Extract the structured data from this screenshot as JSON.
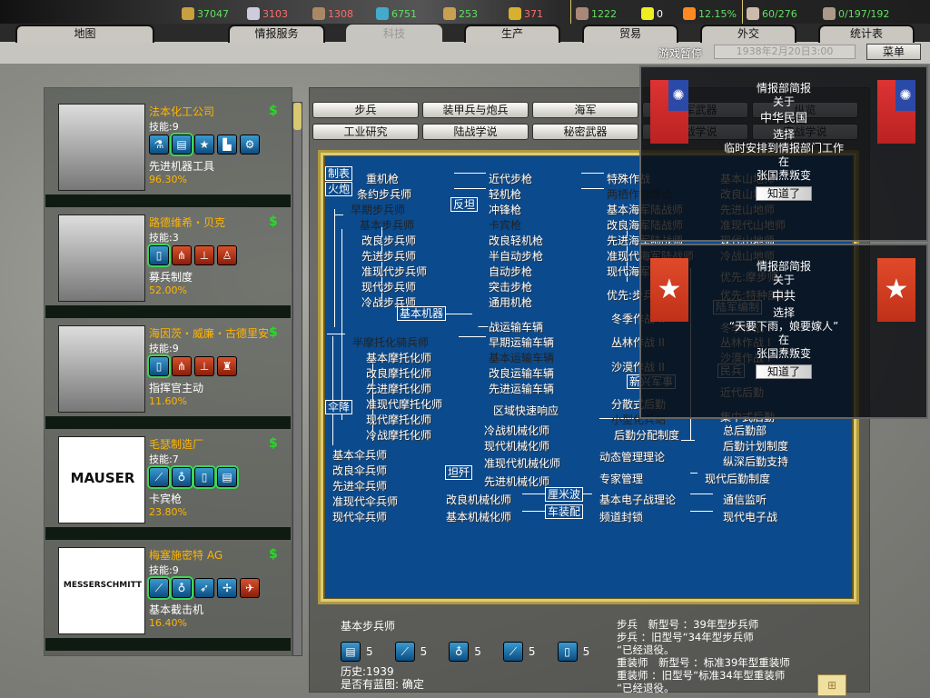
{
  "resources": [
    {
      "name": "energy",
      "icon": "energy-icon",
      "value": "37047",
      "color": "#5fe05f"
    },
    {
      "name": "metal",
      "icon": "metal-icon",
      "value": "3103",
      "color": "#ff6b6b"
    },
    {
      "name": "rare-materials",
      "icon": "rare-materials-icon",
      "value": "1308",
      "color": "#ff6b6b"
    },
    {
      "name": "oil",
      "icon": "oil-icon",
      "value": "6751",
      "color": "#5fe05f"
    },
    {
      "name": "supplies",
      "icon": "supplies-icon",
      "value": "253",
      "color": "#5fe05f"
    },
    {
      "name": "money",
      "icon": "money-icon",
      "value": "371",
      "color": "#ff6b6b"
    },
    {
      "name": "manpower",
      "icon": "manpower-icon",
      "value": "1222",
      "color": "#5fe05f"
    },
    {
      "name": "nuclear",
      "icon": "nuclear-icon",
      "value": "0",
      "color": "#ffffff"
    },
    {
      "name": "dissent",
      "icon": "dissent-icon",
      "value": "12.15%",
      "color": "#5fe05f"
    },
    {
      "name": "transport",
      "icon": "transport-icon",
      "value": "60/276",
      "color": "#5fe05f"
    },
    {
      "name": "ic",
      "icon": "industry-icon",
      "value": "0/197/192",
      "color": "#5fe05f"
    }
  ],
  "tabs": [
    "地图",
    "情报服务",
    "科技",
    "生产",
    "贸易",
    "外交",
    "统计表"
  ],
  "active_tab": "科技",
  "status": {
    "paused": "游戏暂停",
    "date": "1938年2月20日3:00",
    "menu": "菜单"
  },
  "teams": [
    {
      "name": "法本化工公司",
      "skill": "技能:9",
      "icons": [
        "flask",
        "blueprint",
        "star",
        "factory",
        "gears"
      ],
      "project": "先进机器工具",
      "progress": "96.30%"
    },
    {
      "name": "路德维希・贝克",
      "skill": "技能:3",
      "icons": [
        "book",
        "infantry-split",
        "org-chart",
        "officer"
      ],
      "project": "募兵制度",
      "progress": "52.00%"
    },
    {
      "name": "海因茨・威廉・古德里安",
      "skill": "技能:9",
      "icons": [
        "book",
        "infantry-split",
        "org-chart",
        "tank-officer"
      ],
      "project": "指挥官主动",
      "progress": "11.60%"
    },
    {
      "name": "毛瑟制造厂",
      "skill": "技能:7",
      "icons": [
        "rifle",
        "lightbulb",
        "book",
        "blueprint"
      ],
      "project": "卡宾枪",
      "progress": "23.80%"
    },
    {
      "name": "梅塞施密特 AG",
      "skill": "技能:9",
      "icons": [
        "rifle",
        "lightbulb",
        "rocket",
        "propeller",
        "aircraft"
      ],
      "project": "基本截击机",
      "progress": "16.40%"
    }
  ],
  "team_logos": [
    "MAUSER",
    "MESSERSCHMITT"
  ],
  "subtabs": [
    [
      "步兵",
      "装甲兵与炮兵",
      "海军",
      "空军武器",
      "纵览"
    ],
    [
      "工业研究",
      "陆战学说",
      "秘密武器",
      "海战学说",
      "空战学说"
    ]
  ],
  "techs": {
    "col1": [
      "重机枪",
      "条约步兵师",
      "早期步兵师",
      "基本步兵师",
      "改良步兵师",
      "先进步兵师",
      "准现代步兵师",
      "现代步兵师",
      "冷战步兵师"
    ],
    "col2": [
      "近代步枪",
      "轻机枪",
      "冲锋枪",
      "卡宾枪",
      "改良轻机枪",
      "半自动步枪",
      "自动步枪",
      "突击步枪",
      "通用机枪"
    ],
    "transport": [
      "一战运输车辆",
      "早期运输车辆",
      "基本运输车辆",
      "改良运输车辆",
      "先进运输车辆"
    ],
    "motor": [
      "半摩托化骑兵师",
      "基本摩托化师",
      "改良摩托化师",
      "先进摩托化师",
      "准现代摩托化师",
      "现代摩托化师",
      "冷战摩托化师"
    ],
    "mech": [
      "区域快速响应",
      "冷战机械化师",
      "现代机械化师",
      "准现代机械化师",
      "先进机械化师",
      "改良机械化师",
      "基本机械化师"
    ],
    "para": [
      "基本伞兵师",
      "改良伞兵师",
      "先进伞兵师",
      "准现代伞兵师",
      "现代伞兵师"
    ],
    "col3": [
      "特殊作战",
      "两栖作战理论",
      "基本海军陆战师",
      "改良海军陆战师",
      "先进海军陆战师",
      "准现代海军陆战师",
      "现代海军陆战师",
      "优先:步兵",
      "冬季作战 II",
      "丛林作战 II",
      "沙漠作战 II",
      "分散式后勤",
      "小型化兵站",
      "后勤分配制度",
      "动态管理理论",
      "专家管理",
      "基本电子战理论",
      "频道封锁"
    ],
    "col4": [
      "基本山地师",
      "改良山地师",
      "先进山地师",
      "准现代山地师",
      "现代山地师",
      "冷战山地师",
      "优先:摩步师",
      "优先:特种部队",
      "冬季作战 I",
      "丛林作战 I",
      "沙漠作战 I",
      "近代后勤",
      "集中式后勤",
      "总后勤部",
      "后勤计划制度",
      "纵深后勤支持",
      "现代后勤制度",
      "通信监听",
      "现代电子战"
    ],
    "labels": [
      "制表",
      "火炮",
      "反坦",
      "基本机器",
      "伞降",
      "坦歼",
      "厘米波",
      "车装配",
      "新兴军事",
      "陆军编制",
      "民兵"
    ]
  },
  "popups": [
    {
      "title": "情报部简报",
      "about": "关于",
      "country": "中华民国",
      "choose": "选择",
      "action": "临时安排到情报部门工作",
      "at": "在",
      "event": "张国焘叛变",
      "ok": "知道了",
      "flag": "roc-flag-icon"
    },
    {
      "title": "情报部简报",
      "about": "关于",
      "country": "中共",
      "choose": "选择",
      "action": "“天要下雨，娘要嫁人”",
      "at": "在",
      "event": "张国焘叛变",
      "ok": "知道了",
      "flag": "ccp-flag-icon"
    }
  ],
  "info": {
    "tech": "基本步兵师",
    "costs": [
      {
        "icon": "blueprint-icon",
        "value": "5"
      },
      {
        "icon": "rifle-icon",
        "value": "5"
      },
      {
        "icon": "lightbulb-icon",
        "value": "5"
      },
      {
        "icon": "rifle-icon",
        "value": "5"
      },
      {
        "icon": "book-icon",
        "value": "5"
      }
    ],
    "history": "历史:1939",
    "blueprint": "是否有蓝图: 确定",
    "effects": [
      "步兵　新型号 ：39年型步兵师",
      "步兵 ：旧型号“34年型步兵师",
      "“已经退役。",
      "重装师　新型号 ：标准39年型重装师",
      "重装师 ：旧型号“标准34年型重装师",
      "“已经退役。"
    ]
  }
}
